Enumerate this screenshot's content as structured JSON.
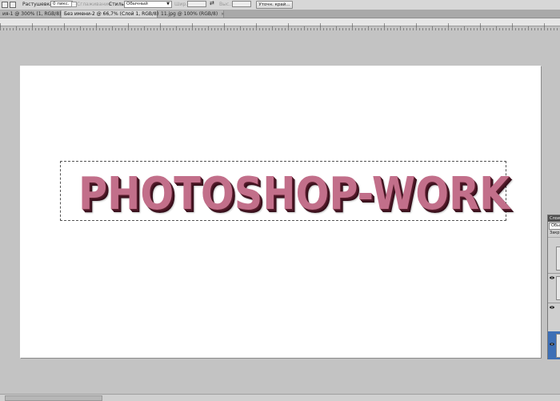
{
  "options_bar": {
    "feather_label": "Растушевка:",
    "feather_value": "0 пикс.",
    "antialias_label": "Сглаживание",
    "style_label": "Стиль:",
    "style_value": "Обычный",
    "width_label": "Шир.:",
    "height_label": "Выс.:",
    "refine_edge_label": "Уточн. край..."
  },
  "tabs": [
    {
      "label": "ия-1 @ 300% (1, RGB/8) *",
      "active": false
    },
    {
      "label": "Без имени-2 @ 66,7% (Слой 1, RGB/8) *",
      "active": true
    },
    {
      "label": "11.jpg @ 100% (RGB/8)",
      "active": false
    }
  ],
  "canvas": {
    "text": "PHOTOSHOP-WORK"
  },
  "layers_panel": {
    "title": "Слои",
    "blend_mode": "Обыч",
    "lock_label": "Закр"
  },
  "colors": {
    "text_fill": "#c26f8a",
    "text_extrude": "#4c1726",
    "workspace": "#c3c3c3"
  }
}
